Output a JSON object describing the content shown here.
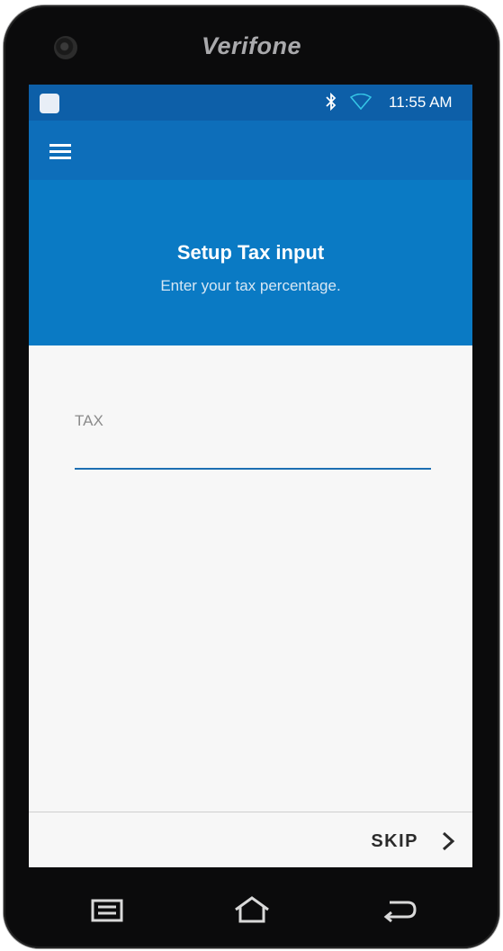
{
  "device": {
    "brand": "Verifone"
  },
  "status_bar": {
    "time": "11:55 AM",
    "icons": [
      "app-notification-icon",
      "bluetooth-icon",
      "wifi-icon"
    ]
  },
  "app_bar": {
    "menu_icon": "hamburger-menu-icon"
  },
  "header": {
    "title": "Setup Tax input",
    "subtitle": "Enter your tax percentage."
  },
  "form": {
    "tax_label": "TAX",
    "tax_value": ""
  },
  "footer": {
    "skip_label": "SKIP",
    "skip_icon": "chevron-right-icon"
  },
  "nav_bar": {
    "buttons": [
      "recent-apps-icon",
      "home-icon",
      "back-icon"
    ]
  },
  "colors": {
    "status_bar": "#0d5fa8",
    "app_bar": "#0d6eba",
    "header": "#0a7ac4",
    "input_underline": "#1d6fb2",
    "body_background": "#f7f7f7"
  }
}
